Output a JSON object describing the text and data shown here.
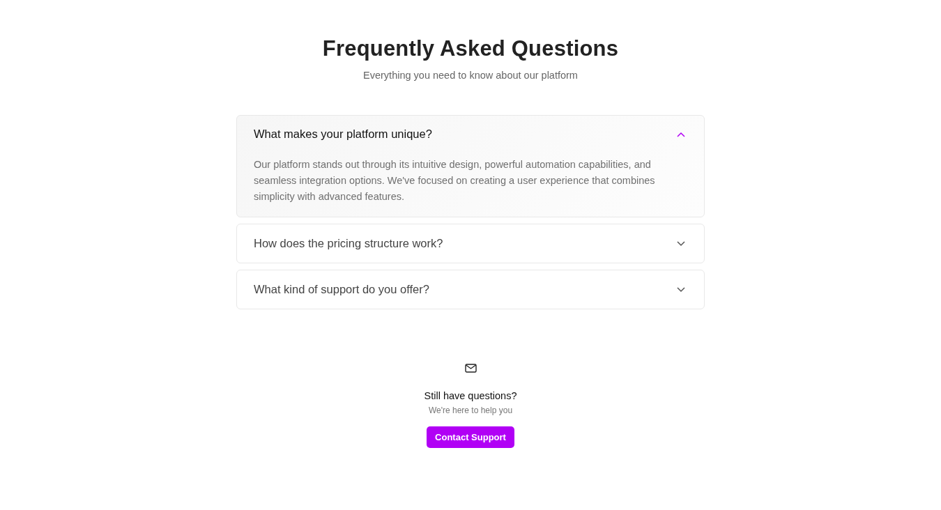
{
  "header": {
    "title": "Frequently Asked Questions",
    "subtitle": "Everything you need to know about our platform"
  },
  "faqs": [
    {
      "question": "What makes your platform unique?",
      "expanded": true,
      "answer": "Our platform stands out through its intuitive design, powerful automation capabilities, and seamless integration options. We've focused on creating a user experience that combines simplicity with advanced features."
    },
    {
      "question": "How does the pricing structure work?",
      "expanded": false
    },
    {
      "question": "What kind of support do you offer?",
      "expanded": false
    }
  ],
  "contact": {
    "title": "Still have questions?",
    "subtitle": "We're here to help you",
    "button": "Contact Support"
  }
}
